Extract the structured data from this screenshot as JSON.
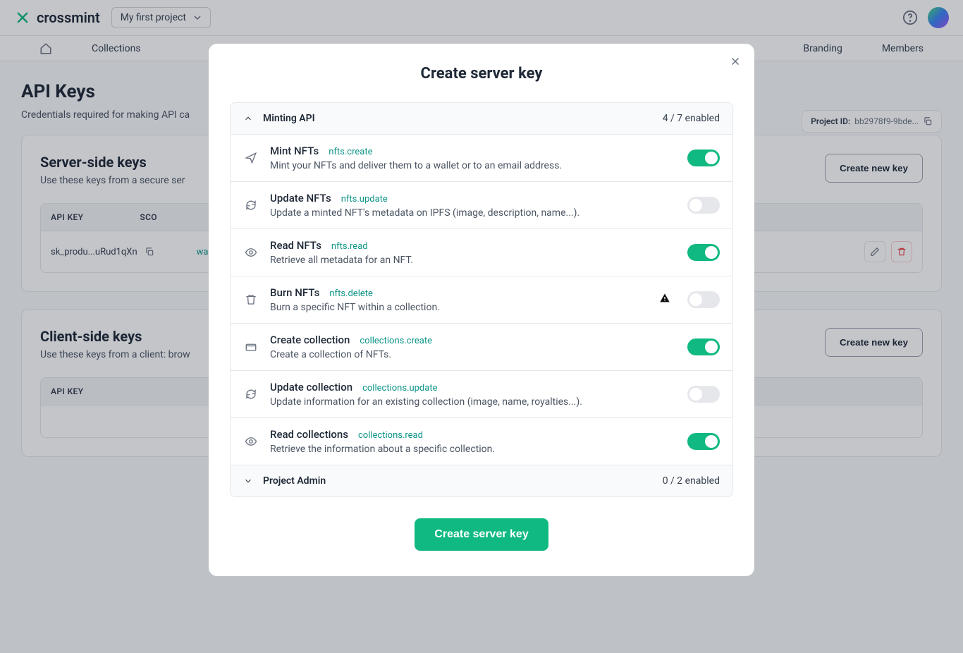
{
  "header": {
    "brand": "crossmint",
    "project_selector": "My first project"
  },
  "nav": {
    "collections": "Collections",
    "branding": "Branding",
    "members": "Members"
  },
  "page": {
    "title": "API Keys",
    "subtitle": "Credentials required for making API ca",
    "project_id_label": "Project ID:",
    "project_id_value": "bb2978f9-9bde..."
  },
  "server_card": {
    "title": "Server-side keys",
    "subtitle": "Use these keys from a secure ser",
    "create_btn": "Create new key",
    "col_api_key": "API KEY",
    "col_scopes": "SCO",
    "row_key": "sk_produ...uRud1qXn",
    "row_scope": "wa"
  },
  "client_card": {
    "title": "Client-side keys",
    "subtitle": "Use these keys from a client: brow",
    "create_btn": "Create new key",
    "col_api_key": "API KEY"
  },
  "modal": {
    "title": "Create server key",
    "submit": "Create server key",
    "groups": [
      {
        "name": "Minting API",
        "count": "4 / 7 enabled",
        "expanded": true,
        "items": [
          {
            "icon": "send",
            "name": "Mint NFTs",
            "scope": "nfts.create",
            "desc": "Mint your NFTs and deliver them to a wallet or to an email address.",
            "on": true,
            "warn": false
          },
          {
            "icon": "refresh",
            "name": "Update NFTs",
            "scope": "nfts.update",
            "desc": "Update a minted NFT's metadata on IPFS (image, description, name...).",
            "on": false,
            "warn": false
          },
          {
            "icon": "eye",
            "name": "Read NFTs",
            "scope": "nfts.read",
            "desc": "Retrieve all metadata for an NFT.",
            "on": true,
            "warn": false
          },
          {
            "icon": "trash",
            "name": "Burn NFTs",
            "scope": "nfts.delete",
            "desc": "Burn a specific NFT within a collection.",
            "on": false,
            "warn": true
          },
          {
            "icon": "wallet",
            "name": "Create collection",
            "scope": "collections.create",
            "desc": "Create a collection of NFTs.",
            "on": true,
            "warn": false
          },
          {
            "icon": "refresh",
            "name": "Update collection",
            "scope": "collections.update",
            "desc": "Update information for an existing collection (image, name, royalties...).",
            "on": false,
            "warn": false
          },
          {
            "icon": "eye",
            "name": "Read collections",
            "scope": "collections.read",
            "desc": "Retrieve the information about a specific collection.",
            "on": true,
            "warn": false
          }
        ]
      },
      {
        "name": "Project Admin",
        "count": "0 / 2 enabled",
        "expanded": false,
        "items": []
      }
    ]
  }
}
